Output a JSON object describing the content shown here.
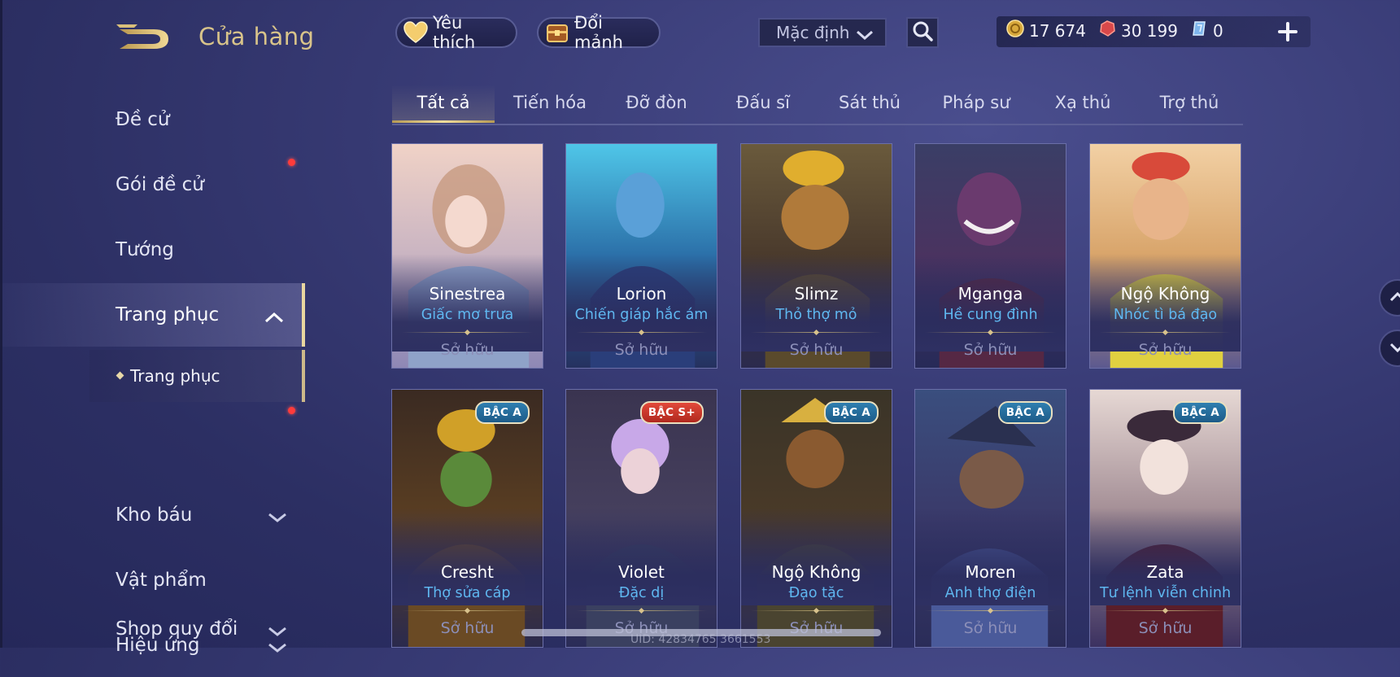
{
  "header": {
    "title": "Cửa hàng",
    "favorite_label": "Yêu thích",
    "swap_label": "Đổi mảnh",
    "sort_select": "Mặc định",
    "currencies": {
      "gold": "17 674",
      "ruby": "30 199",
      "gem": "0"
    }
  },
  "sidebar": {
    "items": [
      {
        "label": "Đề cử"
      },
      {
        "label": "Gói đề cử"
      },
      {
        "label": "Tướng"
      },
      {
        "label": "Trang phục"
      },
      {
        "label": "Kho báu"
      },
      {
        "label": "Vật phẩm"
      },
      {
        "label": "Hiệu ứng"
      },
      {
        "label": "Shop quy đổi"
      }
    ],
    "sub_item": "Trang phục"
  },
  "tabs": [
    "Tất cả",
    "Tiến hóa",
    "Đỡ đòn",
    "Đấu sĩ",
    "Sát thủ",
    "Pháp sư",
    "Xạ thủ",
    "Trợ thủ"
  ],
  "cards": [
    {
      "hero": "Sinestrea",
      "skin": "Giấc mơ trưa",
      "status": "Sở hữu"
    },
    {
      "hero": "Lorion",
      "skin": "Chiến giáp hắc ám",
      "status": "Sở hữu"
    },
    {
      "hero": "Slimz",
      "skin": "Thỏ thợ mỏ",
      "status": "Sở hữu"
    },
    {
      "hero": "Mganga",
      "skin": "Hề cung đình",
      "status": "Sở hữu"
    },
    {
      "hero": "Ngộ Không",
      "skin": "Nhóc tì bá đạo",
      "status": "Sở hữu"
    },
    {
      "hero": "Cresht",
      "skin": "Thợ sửa cáp",
      "status": "Sở hữu",
      "badge": "BẬC A"
    },
    {
      "hero": "Violet",
      "skin": "Đặc dị",
      "status": "Sở hữu",
      "badge": "BẬC S+"
    },
    {
      "hero": "Ngộ Không",
      "skin": "Đạo tặc",
      "status": "Sở hữu",
      "badge": "BẬC A"
    },
    {
      "hero": "Moren",
      "skin": "Anh thợ điện",
      "status": "Sở hữu",
      "badge": "BẬC A"
    },
    {
      "hero": "Zata",
      "skin": "Tư lệnh viễn chinh",
      "status": "Sở hữu",
      "badge": "BẬC A"
    }
  ],
  "footer": {
    "uid": "UID: 42834765 3661553"
  },
  "colors": {
    "accent_gold": "#e9d7a0",
    "skin_name": "#5fb7f0",
    "badge_a": "#2f7fb0",
    "badge_splus": "#e24a3a",
    "notification": "#ff3b3b"
  },
  "icons": [
    "back-logo-icon",
    "heart-icon",
    "chest-icon",
    "chevron-down-icon",
    "search-icon",
    "gold-coin-icon",
    "ruby-icon",
    "gem-icon",
    "plus-icon",
    "chevron-up-icon"
  ]
}
